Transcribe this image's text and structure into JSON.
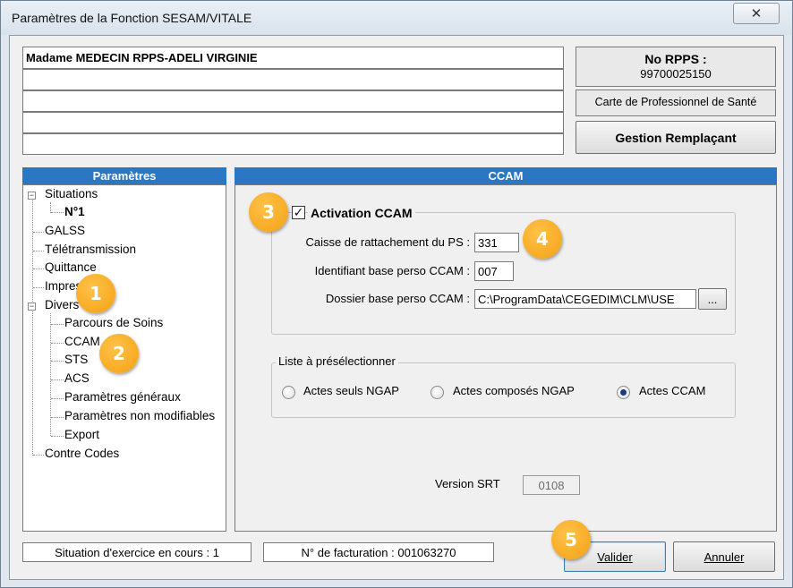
{
  "window": {
    "title": "Paramètres de la Fonction SESAM/VITALE",
    "close_label": "✕"
  },
  "header": {
    "doctor_name": "Madame MEDECIN RPPS-ADELI VIRGINIE",
    "rpps_title": "No RPPS :",
    "rpps_number": "99700025150",
    "card_label": "Carte de Professionnel de Santé",
    "replacement_button": "Gestion Remplaçant"
  },
  "params_panel": {
    "title": "Paramètres",
    "tree": {
      "situations": "Situations",
      "n1": "N°1",
      "galss": "GALSS",
      "teletransmission": "Télétransmission",
      "quittance": "Quittance",
      "impression": "Impres",
      "divers": "Divers",
      "parcours": "Parcours de Soins",
      "ccam": "CCAM",
      "sts": "STS",
      "acs": "ACS",
      "parametres_generaux": "Paramètres généraux",
      "parametres_non_modifiables": "Paramètres non modifiables",
      "export": "Export",
      "contre_codes": "Contre Codes"
    }
  },
  "ccam_panel": {
    "title": "CCAM",
    "activation_label": "Activation CCAM",
    "activation_checked": true,
    "caisse_label": "Caisse de rattachement du PS :",
    "caisse_value": "331",
    "identifiant_label": "Identifiant base perso CCAM :",
    "identifiant_value": "007",
    "dossier_label": "Dossier base perso CCAM :",
    "dossier_value": "C:\\ProgramData\\CEGEDIM\\CLM\\USE",
    "browse_label": "...",
    "list_group_title": "Liste à présélectionner",
    "radio_options": [
      "Actes seuls NGAP",
      "Actes composés NGAP",
      "Actes CCAM"
    ],
    "selected_option": "Actes CCAM",
    "version_label": "Version SRT",
    "version_value": "0108"
  },
  "status": {
    "situation": "Situation d'exercice en cours : 1",
    "facturation": "N° de facturation : 001063270"
  },
  "buttons": {
    "valider": "Valider",
    "annuler": "Annuler"
  },
  "badges": [
    "1",
    "2",
    "3",
    "4",
    "5"
  ],
  "colors": {
    "panel_header": "#2a78c4",
    "badge": "#f4a011"
  }
}
